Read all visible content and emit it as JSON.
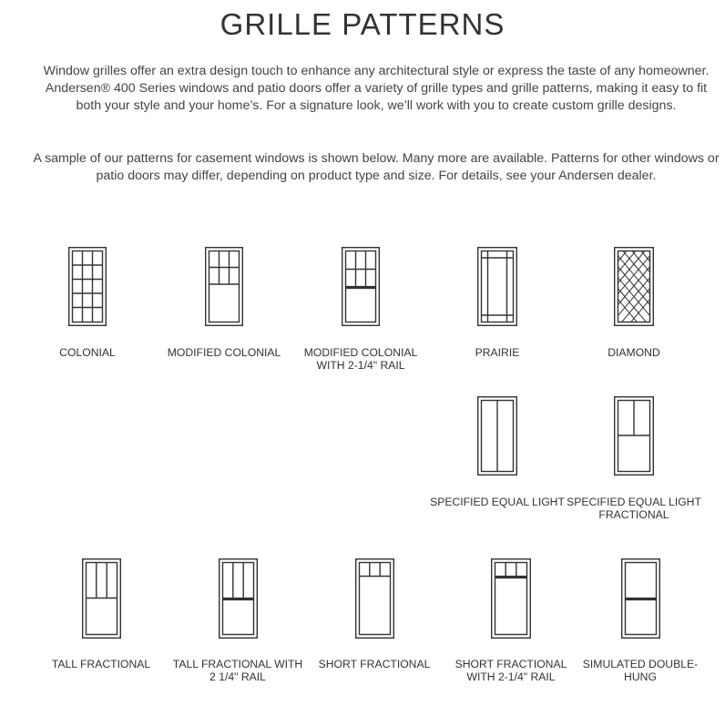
{
  "page": {
    "title": "GRILLE PATTERNS",
    "intro": "Window grilles offer an extra design touch to enhance any architectural style or express the taste of any homeowner. Andersen® 400 Series windows and patio doors offer a variety of grille types and grille patterns, making it easy to fit both your style and your home’s. For a signature look, we’ll work with you to create custom grille designs.",
    "note": "A sample of our patterns for casement windows is shown below. Many more are available. Patterns for other windows or patio doors may differ, depending on product type and size. For details, see your Andersen dealer."
  },
  "patterns": [
    {
      "label": "COLONIAL",
      "icon": "colonial-window-icon"
    },
    {
      "label": "MODIFIED COLONIAL",
      "icon": "modified-colonial-window-icon"
    },
    {
      "label": "MODIFIED COLONIAL WITH 2-1/4\" RAIL",
      "icon": "modified-colonial-rail-window-icon"
    },
    {
      "label": "PRAIRIE",
      "icon": "prairie-window-icon"
    },
    {
      "label": "DIAMOND",
      "icon": "diamond-window-icon"
    },
    {
      "label": "SPECIFIED EQUAL LIGHT",
      "icon": "specified-equal-light-window-icon"
    },
    {
      "label": "SPECIFIED EQUAL LIGHT FRACTIONAL",
      "icon": "specified-equal-light-fractional-window-icon"
    },
    {
      "label": "TALL FRACTIONAL",
      "icon": "tall-fractional-window-icon"
    },
    {
      "label": "TALL FRACTIONAL WITH 2 1/4\" RAIL",
      "icon": "tall-fractional-rail-window-icon"
    },
    {
      "label": "SHORT FRACTIONAL",
      "icon": "short-fractional-window-icon"
    },
    {
      "label": "SHORT FRACTIONAL WITH 2-1/4\" RAIL",
      "icon": "short-fractional-rail-window-icon"
    },
    {
      "label": "SIMULATED DOUBLE-HUNG",
      "icon": "simulated-double-hung-window-icon"
    }
  ]
}
